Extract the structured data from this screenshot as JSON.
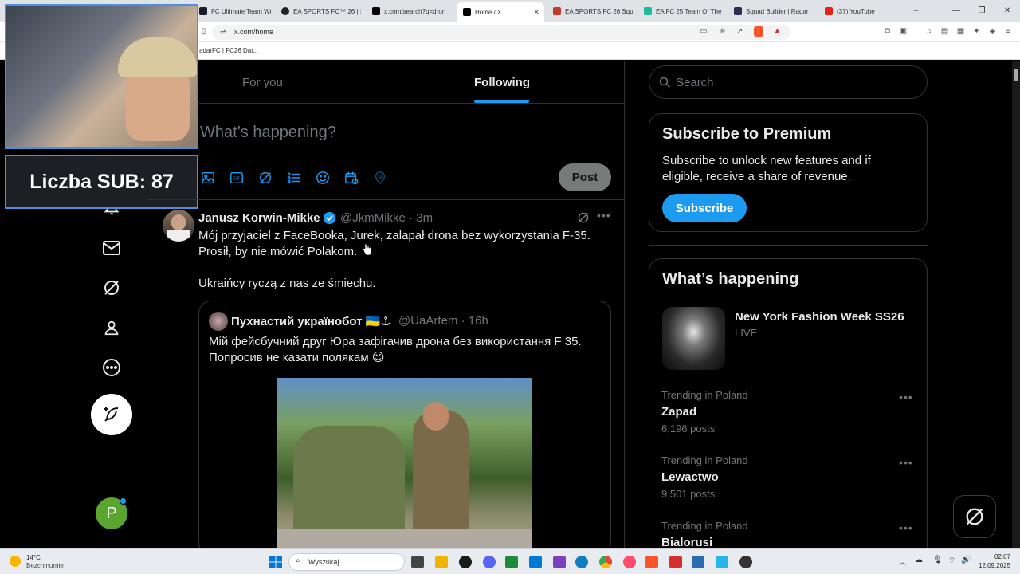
{
  "browser": {
    "tabs": [
      {
        "label": "FC Ultimate Team Web",
        "color": "#1a1a2e"
      },
      {
        "label": "EA SPORTS FC™ 26 | S",
        "color": "#222"
      },
      {
        "label": "x.com/search?q=dron",
        "color": "#000"
      },
      {
        "label": "Home / X",
        "color": "#000"
      },
      {
        "label": "EA SPORTS FC 26 Squa",
        "color": "#c0392b"
      },
      {
        "label": "EA FC 25 Team Of The",
        "color": "#1abc9c"
      },
      {
        "label": "Squad Builder | Radar",
        "color": "#2c2c54"
      },
      {
        "label": "(37) YouTube",
        "color": "#e62117"
      }
    ],
    "url": "x.com/home",
    "bookmark": "adarFC | FC26 Dat..."
  },
  "overlay": {
    "sub_label": "Liczba SUB: 87"
  },
  "timeline": {
    "tabs": [
      "For you",
      "Following"
    ],
    "compose_placeholder": "What’s happening?",
    "post_button": "Post"
  },
  "tweet": {
    "author": "Janusz Korwin-Mikke",
    "handle": "@JkmMikke",
    "time": "· 3m",
    "line1": "Mój przyjaciel z FaceBooka, Jurek, zalapał drona bez wykorzystania F-35.",
    "line2": "Prosił, by nie mówić Polakom.",
    "line3": "Ukraińcy ryczą z nas ze śmiechu.",
    "quote": {
      "author": "Пухнастий українобот 🇺🇦⚓",
      "handle": "@UaArtem",
      "time": "· 16h",
      "line1": "Мій фейсбучний друг Юра зафігачив дрона без використання F 35.",
      "line2": "Попросив не казати полякам 😉"
    }
  },
  "sidebar": {
    "search_placeholder": "Search",
    "premium": {
      "title": "Subscribe to Premium",
      "text1": "Subscribe to unlock new features and if",
      "text2": "eligible, receive a share of revenue.",
      "button": "Subscribe"
    },
    "happening": {
      "title": "What’s happening",
      "event_title": "New York Fashion Week SS26",
      "event_status": "LIVE",
      "trends": [
        {
          "category": "Trending in Poland",
          "name": "Zapad",
          "posts": "6,196 posts"
        },
        {
          "category": "Trending in Poland",
          "name": "Lewactwo",
          "posts": "9,501 posts"
        },
        {
          "category": "Trending in Poland",
          "name": "Bialorusi",
          "posts": ""
        }
      ]
    }
  },
  "profile": {
    "initial": "P"
  },
  "taskbar": {
    "weather_temp": "14°C",
    "weather_desc": "Bezchmurnie",
    "search": "Wyszukaj",
    "time": "02:07",
    "date": "12.09.2025"
  },
  "colors": {
    "accent": "#1d9bf0",
    "premium_btn": "#1d9bf0",
    "avatar": "#59a52f"
  }
}
